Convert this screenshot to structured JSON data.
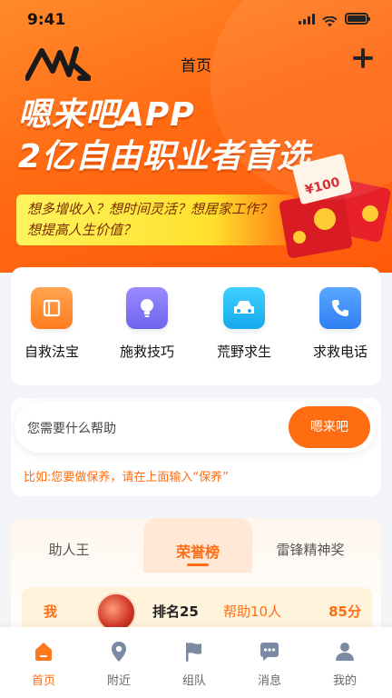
{
  "status_bar": {
    "time": "9:41"
  },
  "header": {
    "title": "首页",
    "logo_text": "MKL"
  },
  "banner": {
    "headline_line1": "嗯来吧APP",
    "headline_line2": "2亿自由职业者首选",
    "slogan": "想多增收入？想时间灵活？想居家工作？想提高人生价值？",
    "envelope_amount": "¥100"
  },
  "services": [
    {
      "label": "自救法宝",
      "icon": "book-icon",
      "color": "#ff8c2b"
    },
    {
      "label": "施救技巧",
      "icon": "lightbulb-icon",
      "color": "#7b72f0"
    },
    {
      "label": "荒野求生",
      "icon": "car-icon",
      "color": "#21b8f2"
    },
    {
      "label": "求救电话",
      "icon": "phone-icon",
      "color": "#3a8cf6"
    }
  ],
  "search": {
    "placeholder": "您需要什么帮助",
    "button_label": "嗯来吧",
    "hint": "比如:您要做保养，请在上面输入“保养”"
  },
  "honor": {
    "tabs": [
      "助人王",
      "荣誉榜",
      "雷锋精神奖"
    ],
    "active_tab": "荣誉榜",
    "my_rank": {
      "me_label": "我",
      "rank": "排名25",
      "helped": "帮助10人",
      "score": "85分"
    }
  },
  "tabbar": [
    {
      "label": "首页",
      "icon": "home-icon",
      "active": true
    },
    {
      "label": "附近",
      "icon": "location-pin-icon",
      "active": false
    },
    {
      "label": "组队",
      "icon": "flag-icon",
      "active": false
    },
    {
      "label": "消息",
      "icon": "message-icon",
      "active": false
    },
    {
      "label": "我的",
      "icon": "user-icon",
      "active": false
    }
  ],
  "colors": {
    "accent": "#ff6d12",
    "banner": "#ff7a1f",
    "slogan_bg": "#ffe63a"
  }
}
